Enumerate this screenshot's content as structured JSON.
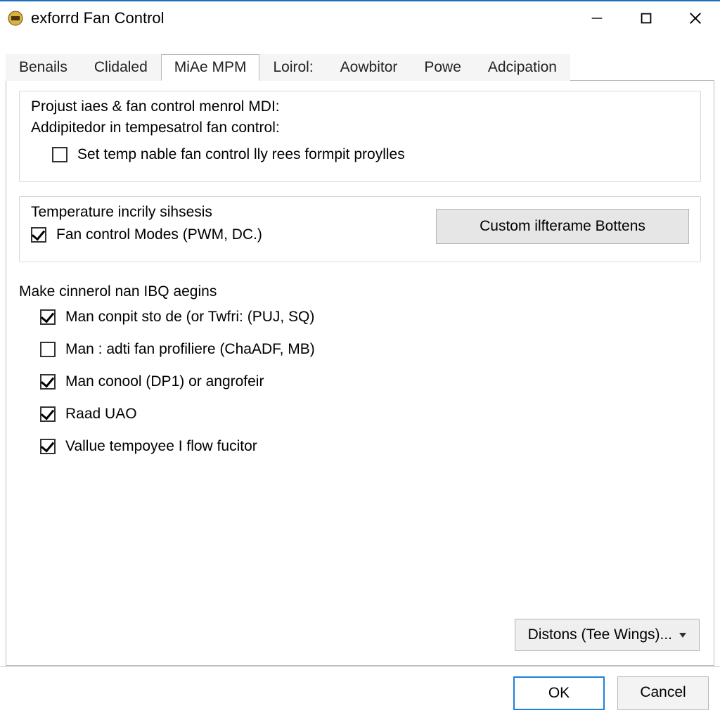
{
  "window": {
    "title": "exforrd Fan Control"
  },
  "tabs": [
    {
      "label": "Benails"
    },
    {
      "label": "Clidaled"
    },
    {
      "label": "MiAe MPM"
    },
    {
      "label": "Loirol:"
    },
    {
      "label": "Aowbitor"
    },
    {
      "label": "Powe"
    },
    {
      "label": "Adcipation"
    }
  ],
  "active_tab_index": 2,
  "group1": {
    "legend": "Projust iaes & fan control menrol MDI:",
    "sublabel": "Addipitedor in tempesatrol fan control:",
    "check1": {
      "label": "Set temp nable fan control lly rees formpit proylles",
      "checked": false
    }
  },
  "group2": {
    "legend": "Temperature incrily sihsesis",
    "check1": {
      "label": "Fan control Modes (PWM, DC.)",
      "checked": true
    },
    "button": "Custom ilfterame Bottens"
  },
  "section": {
    "title": "Make cinnerol nan IBQ aegins",
    "items": [
      {
        "label": "Man conpit sto de (or Twfri: (PUJ, SQ)",
        "checked": true
      },
      {
        "label": "Man : adti fan profiliere (ChaADF, MB)",
        "checked": false
      },
      {
        "label": "Man conool (DP1) or angrofeir",
        "checked": true
      },
      {
        "label": "Raad UAO",
        "checked": true
      },
      {
        "label": "Vallue tempoyee I flow fucitor",
        "checked": true
      }
    ]
  },
  "dropdown_label": "Distons (Tee Wings)...",
  "footer": {
    "ok": "OK",
    "cancel": "Cancel"
  }
}
